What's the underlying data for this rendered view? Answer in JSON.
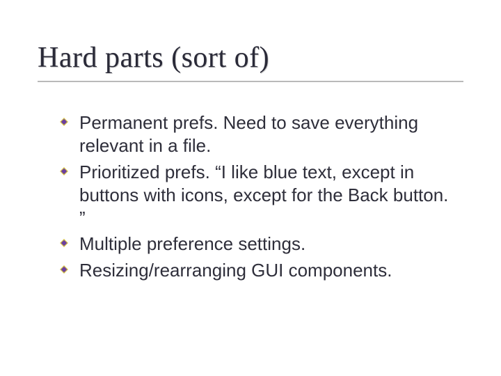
{
  "slide": {
    "title": "Hard parts (sort of)",
    "bullets": [
      " Permanent prefs.  Need to save everything relevant in a file.",
      " Prioritized prefs.  “I like blue text, except in buttons with icons, except for the Back button. ”",
      " Multiple preference settings.",
      " Resizing/rearranging GUI components."
    ]
  },
  "colors": {
    "bullet_fill": "#6b3fa0",
    "bullet_stroke": "#d6c24a",
    "rule": "#b9b9b9"
  }
}
